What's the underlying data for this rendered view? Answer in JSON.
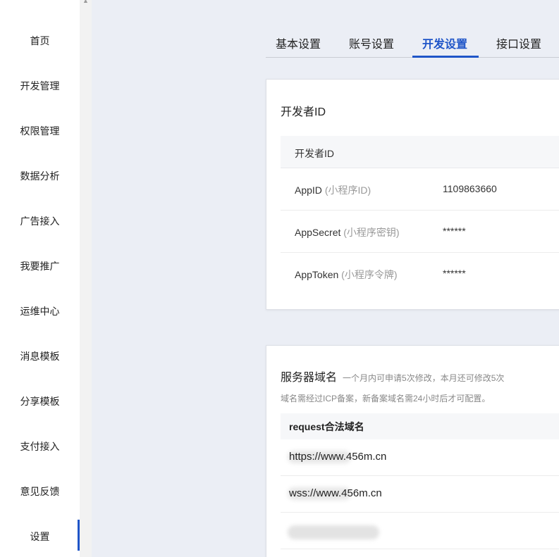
{
  "sidebar": {
    "items": [
      {
        "label": "首页"
      },
      {
        "label": "开发管理"
      },
      {
        "label": "权限管理"
      },
      {
        "label": "数据分析"
      },
      {
        "label": "广告接入"
      },
      {
        "label": "我要推广"
      },
      {
        "label": "运维中心"
      },
      {
        "label": "消息模板"
      },
      {
        "label": "分享模板"
      },
      {
        "label": "支付接入"
      },
      {
        "label": "意见反馈"
      },
      {
        "label": "设置"
      }
    ],
    "active": "设置"
  },
  "tabs": [
    {
      "label": "基本设置"
    },
    {
      "label": "账号设置"
    },
    {
      "label": "开发设置"
    },
    {
      "label": "接口设置"
    }
  ],
  "active_tab": "开发设置",
  "developer_card": {
    "title": "开发者ID",
    "table_header": "开发者ID",
    "rows": [
      {
        "key": "AppID",
        "hint": "(小程序ID)",
        "value": "1109863660"
      },
      {
        "key": "AppSecret",
        "hint": "(小程序密钥)",
        "value": "******"
      },
      {
        "key": "AppToken",
        "hint": "(小程序令牌)",
        "value": "******"
      }
    ]
  },
  "server_card": {
    "title": "服务器域名",
    "note": "一个月内可申请5次修改，本月还可修改5次",
    "desc": "域名需经过ICP备案，新备案域名需24小时后才可配置。",
    "domain_header": "request合法域名",
    "domains": [
      "https://www.456m.cn",
      "wss://www.456m.cn",
      ""
    ]
  },
  "colors": {
    "accent": "#1f55c8",
    "background": "#ebeef5"
  }
}
